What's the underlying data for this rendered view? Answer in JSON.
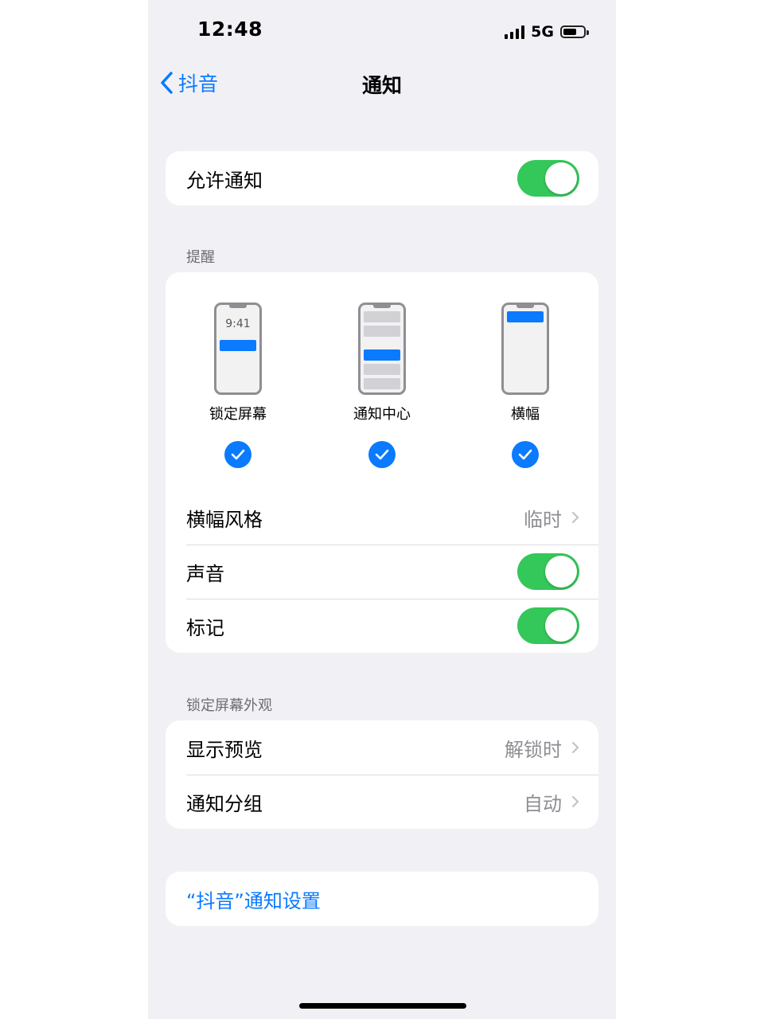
{
  "status_bar": {
    "time": "12:48",
    "network": "5G"
  },
  "nav": {
    "back_label": "抖音",
    "title": "通知"
  },
  "allow": {
    "label": "允许通知",
    "on": true
  },
  "alerts": {
    "header": "提醒",
    "styles": [
      {
        "label": "锁定屏幕",
        "screen_time": "9:41",
        "checked": true
      },
      {
        "label": "通知中心",
        "checked": true
      },
      {
        "label": "横幅",
        "checked": true
      }
    ],
    "banner_style": {
      "label": "横幅风格",
      "value": "临时"
    },
    "sounds": {
      "label": "声音",
      "on": true
    },
    "badges": {
      "label": "标记",
      "on": true
    }
  },
  "lock_screen": {
    "header": "锁定屏幕外观",
    "previews": {
      "label": "显示预览",
      "value": "解锁时"
    },
    "grouping": {
      "label": "通知分组",
      "value": "自动"
    }
  },
  "app_settings": {
    "label": "“抖音”通知设置"
  },
  "colors": {
    "accent": "#0a7aff",
    "toggle_on": "#34c759",
    "background": "#f1f1f5"
  }
}
